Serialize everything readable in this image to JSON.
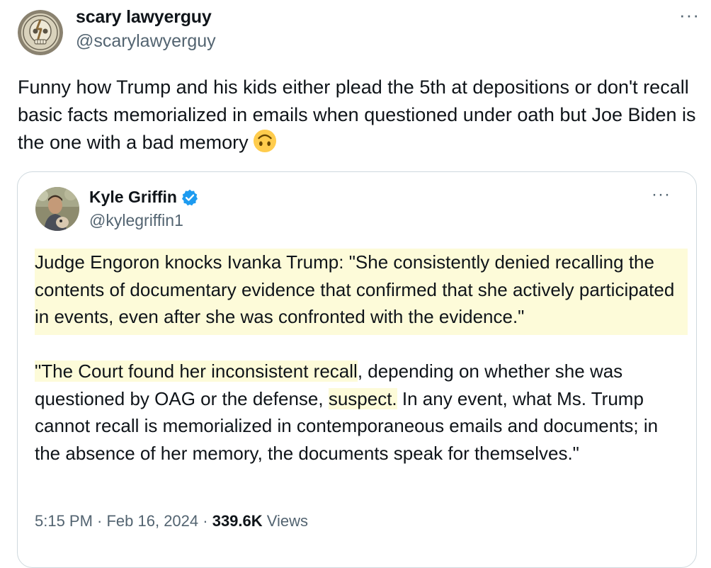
{
  "author": {
    "name": "scary lawyerguy",
    "handle": "@scarylawyerguy",
    "avatar_icon": "steal-your-face-icon"
  },
  "more_icon": "···",
  "tweet": {
    "text": "Funny how Trump and his kids either plead the 5th at depositions or don't recall basic facts memorialized in emails when questioned under oath but Joe Biden is the one with a bad memory",
    "emoji_icon": "upside-down-face-emoji"
  },
  "quoted": {
    "name": "Kyle Griffin",
    "handle": "@kylegriffin1",
    "verified_color": "#1d9bf0",
    "para1": "Judge Engoron knocks Ivanka Trump: \"She consistently denied recalling the contents of documentary evidence that confirmed that she actively participated in events, even after she was confronted with the evidence.\"",
    "para2_hl1": "\"The Court found her inconsistent recall",
    "para2_mid": ", depending on whether she was questioned by OAG or the defense, ",
    "para2_hl2": "suspect.",
    "para2_end": " In any event, what Ms. Trump cannot recall is memorialized in contemporaneous emails and documents; in the absence of her memory, the documents speak for themselves.\"",
    "time": "5:15 PM · Feb 16, 2024 · ",
    "views_count": "339.6K",
    "views_label": " Views"
  },
  "colors": {
    "text": "#0f1419",
    "secondary": "#536471",
    "border": "#cfd9de",
    "highlight": "#fdfbd9"
  }
}
